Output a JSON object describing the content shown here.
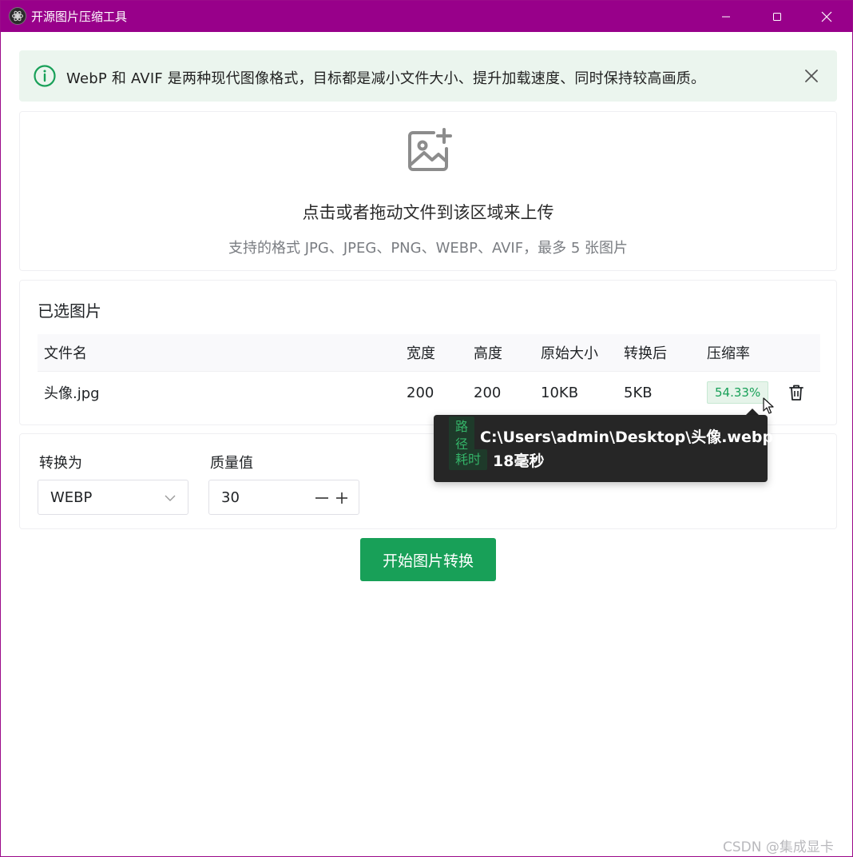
{
  "window": {
    "title": "开源图片压缩工具",
    "accent": "#98008a"
  },
  "alert": {
    "text": "WebP 和 AVIF 是两种现代图像格式，目标都是减小文件大小、提升加载速度、同时保持较高画质。",
    "icon": "info-circle-icon",
    "close_icon": "close-icon"
  },
  "upload": {
    "icon": "image-plus-icon",
    "title": "点击或者拖动文件到该区域来上传",
    "subtitle": "支持的格式 JPG、JPEG、PNG、WEBP、AVIF，最多 5 张图片"
  },
  "selected": {
    "title": "已选图片",
    "columns": [
      "文件名",
      "宽度",
      "高度",
      "原始大小",
      "转换后",
      "压缩率"
    ],
    "rows": [
      {
        "name": "头像.jpg",
        "width": "200",
        "height": "200",
        "original": "10KB",
        "converted": "5KB",
        "ratio": "54.33%"
      }
    ]
  },
  "tooltip": {
    "path_label": "路径",
    "path_value": "C:\\Users\\admin\\Desktop\\头像.webp",
    "time_label": "耗时",
    "time_value": "18毫秒"
  },
  "settings": {
    "format_label": "转换为",
    "format_value": "WEBP",
    "quality_label": "质量值",
    "quality_value": "30"
  },
  "actions": {
    "start_label": "开始图片转换"
  },
  "watermark": "CSDN @集成显卡",
  "colors": {
    "primary": "#18a058",
    "alert_bg": "#ebf5ee",
    "tooltip_bg": "#262626"
  }
}
